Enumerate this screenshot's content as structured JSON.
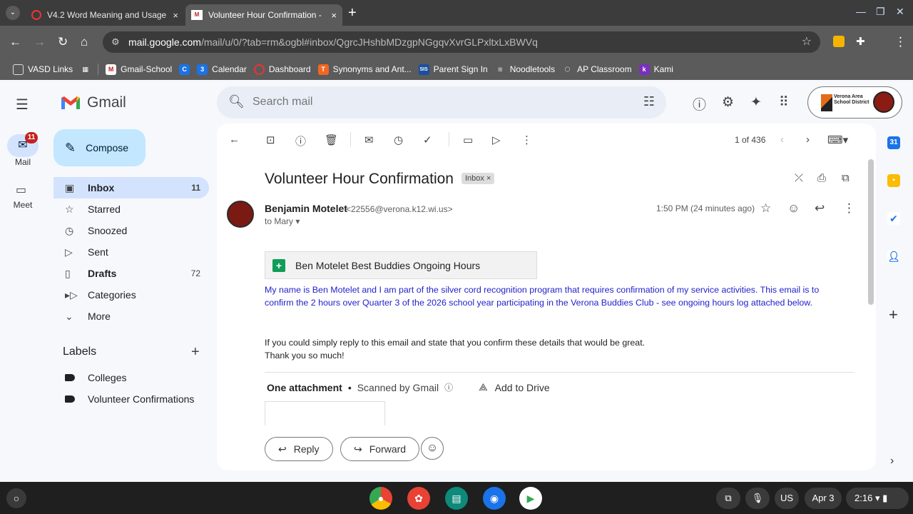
{
  "browser": {
    "tabs": [
      {
        "title": "V4.2 Word Meaning and Usage",
        "close": "×"
      },
      {
        "title": "Volunteer Hour Confirmation - ",
        "close": "×"
      }
    ],
    "new_tab": "+",
    "url_host": "mail.google.com",
    "url_path": "/mail/u/0/?tab=rm&ogbl#inbox/QgrcJHshbMDzgpNGgqvXvrGLPxltxLxBWVq",
    "bookmarks": [
      {
        "label": "VASD Links",
        "color": "#5b5b5b"
      },
      {
        "label": "",
        "color": "#5b5b5b"
      },
      {
        "label": "Gmail-School",
        "color": "#c5221f"
      },
      {
        "label": "",
        "color": "#1a73e8"
      },
      {
        "label": "Calendar",
        "color": "#1a73e8"
      },
      {
        "label": "Dashboard",
        "color": "#e33"
      },
      {
        "label": "Synonyms and Ant...",
        "color": "#f26722"
      },
      {
        "label": "Parent Sign In",
        "color": "#1a4fa0"
      },
      {
        "label": "Noodletools",
        "color": "#5b5b5b"
      },
      {
        "label": "AP Classroom",
        "color": "#5b5b5b"
      },
      {
        "label": "Kami",
        "color": "#7b2fbe"
      }
    ],
    "bookmark_icon_text": [
      "",
      "",
      "M",
      "C",
      "3",
      "",
      "T",
      "SIS",
      "",
      "",
      "k"
    ]
  },
  "gmail": {
    "logo_text": "Gmail",
    "search_placeholder": "Search mail",
    "rail": {
      "mail_label": "Mail",
      "mail_badge": "11",
      "meet_label": "Meet"
    },
    "compose_label": "Compose",
    "nav": [
      {
        "label": "Inbox",
        "count": "11"
      },
      {
        "label": "Starred",
        "count": ""
      },
      {
        "label": "Snoozed",
        "count": ""
      },
      {
        "label": "Sent",
        "count": ""
      },
      {
        "label": "Drafts",
        "count": "72"
      },
      {
        "label": "Categories",
        "count": ""
      },
      {
        "label": "More",
        "count": ""
      }
    ],
    "labels_heading": "Labels",
    "labels": [
      "Colleges",
      "Volunteer Confirmations"
    ],
    "account_logo_text": "Verona Area School District"
  },
  "message": {
    "pager": "1 of 436",
    "subject": "Volunteer Hour Confirmation",
    "inbox_chip": "Inbox ×",
    "sender_name": "Benjamin Motelet",
    "sender_email": "<22556@verona.k12.wi.us>",
    "to_line": "to Mary ▾",
    "time": "1:50 PM (24 minutes ago)",
    "attachment_chip": "Ben Motelet Best Buddies Ongoing Hours",
    "body_blue": "My name is Ben Motelet and I am part of the silver cord recognition program that requires confirmation of my service activities. This email is to confirm the 2 hours over Quarter 3 of the 2026 school year participating in the Verona Buddies Club - see ongoing hours log attached below.",
    "body_black_1": "If you could simply reply to this email and state that you confirm these details that would be great.",
    "body_black_2": "Thank you so much!",
    "attach_count": "One attachment",
    "scanned": "Scanned by Gmail",
    "add_drive": "Add to Drive",
    "reply": "Reply",
    "forward": "Forward"
  },
  "shelf": {
    "date": "Apr 3",
    "time": "2:16",
    "ime": "US"
  },
  "colors": {
    "accent_blue": "#1a73e8",
    "body_blue_text": "#2222cc",
    "active_nav": "#d3e3fd",
    "compose": "#c2e7ff"
  }
}
